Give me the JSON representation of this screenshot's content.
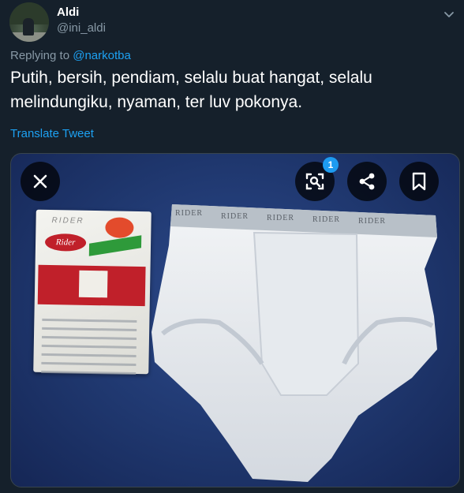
{
  "tweet": {
    "author_name": "Aldi",
    "author_handle": "@ini_aldi",
    "replying_prefix": "Replying to ",
    "replying_to": "@narkotba",
    "text": "Putih, bersih, pendiam, selalu buat hangat, selalu melindungiku, nyaman, ter luv pokonya.",
    "translate_label": "Translate Tweet"
  },
  "media": {
    "badge_count": "1",
    "package_brand": "Rider",
    "package_top_text": "RIDER",
    "waistband_text": [
      "RIDER",
      "RIDER",
      "RIDER",
      "RIDER",
      "RIDER"
    ],
    "icons": {
      "close": "close-icon",
      "lens": "visual-search-icon",
      "share": "share-icon",
      "bookmark": "bookmark-icon",
      "more": "chevron-down-icon"
    }
  },
  "colors": {
    "background": "#15202b",
    "accent": "#1da1f2",
    "secondary_text": "#8899a6"
  }
}
